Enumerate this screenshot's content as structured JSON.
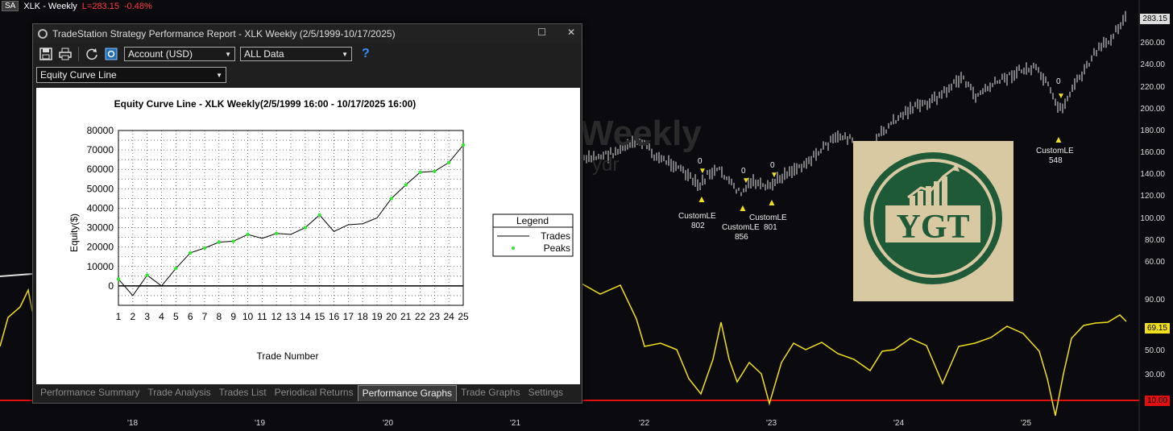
{
  "symbol_bar": {
    "badge": "SA",
    "title": "XLK - Weekly",
    "last": "L=283.15",
    "change": "-0.48%"
  },
  "price_axis": {
    "labels": [
      "260.00",
      "240.00",
      "220.00",
      "200.00",
      "180.00",
      "160.00",
      "140.00",
      "120.00",
      "100.00",
      "80.00",
      "60.00"
    ],
    "last_price_tag": "283.15"
  },
  "indicator_axis": {
    "labels": [
      "90.00",
      "50.00",
      "30.00"
    ],
    "current_value_tag": "69.15",
    "threshold_tag": "10.00"
  },
  "date_axis": {
    "labels": [
      "'18",
      "'19",
      "'20",
      "'21",
      "'22",
      "'23",
      "'24",
      "'25"
    ]
  },
  "trade_markers": [
    {
      "top_label": "0",
      "name": "CustomLE",
      "number": "802"
    },
    {
      "top_label": "0",
      "name": "CustomLE",
      "number": "856"
    },
    {
      "top_label": "0",
      "name": "CustomLE",
      "number": "801"
    },
    {
      "top_label": "0",
      "name": "CustomLE",
      "number": "548"
    }
  ],
  "watermark": {
    "text": "Weekly",
    "subtext": "ydr"
  },
  "logo": {
    "text": "YGT",
    "bg_color": "#d8c9a3",
    "ring_color": "#1e5a37"
  },
  "report": {
    "title": "TradeStation Strategy Performance Report - XLK Weekly (2/5/1999-10/17/2025)",
    "window_buttons": {
      "maximize": "☐",
      "close": "✕"
    },
    "account_select": "Account (USD)",
    "data_select": "ALL Data",
    "help": "?",
    "graph_select": "Equity Curve Line",
    "tabs": [
      {
        "label": "Performance Summary",
        "active": false
      },
      {
        "label": "Trade Analysis",
        "active": false
      },
      {
        "label": "Trades List",
        "active": false
      },
      {
        "label": "Periodical Returns",
        "active": false
      },
      {
        "label": "Performance Graphs",
        "active": true
      },
      {
        "label": "Trade Graphs",
        "active": false
      },
      {
        "label": "Settings",
        "active": false
      }
    ]
  },
  "chart_data": {
    "type": "line",
    "title": "Equity Curve Line - XLK Weekly(2/5/1999 16:00 - 10/17/2025 16:00)",
    "xlabel": "Trade Number",
    "ylabel": "Equity($)",
    "x": [
      1,
      2,
      3,
      4,
      5,
      6,
      7,
      8,
      9,
      10,
      11,
      12,
      13,
      14,
      15,
      16,
      17,
      18,
      19,
      20,
      21,
      22,
      23,
      24,
      25
    ],
    "series": [
      {
        "name": "Trades",
        "values": [
          3500,
          -5000,
          5500,
          0,
          9000,
          17000,
          19500,
          22500,
          23000,
          26500,
          24500,
          27000,
          26500,
          30000,
          36500,
          28000,
          31500,
          32000,
          35000,
          45000,
          52000,
          58500,
          59000,
          63500,
          72500
        ]
      }
    ],
    "peaks": {
      "name": "Peaks",
      "x": [
        1,
        3,
        5,
        6,
        7,
        8,
        9,
        10,
        12,
        14,
        15,
        20,
        21,
        22,
        23,
        24,
        25
      ],
      "values": [
        3500,
        5500,
        9000,
        17000,
        19500,
        22500,
        23000,
        26500,
        27000,
        30000,
        36500,
        45000,
        52000,
        58500,
        59000,
        63500,
        72500
      ]
    },
    "ylim": [
      -10000,
      80000
    ],
    "yticks": [
      "80000",
      "70000",
      "60000",
      "50000",
      "40000",
      "30000",
      "20000",
      "10000",
      "0"
    ],
    "legend": {
      "title": "Legend",
      "items": [
        "Trades",
        "Peaks"
      ],
      "placement": "right"
    },
    "grid": true
  }
}
